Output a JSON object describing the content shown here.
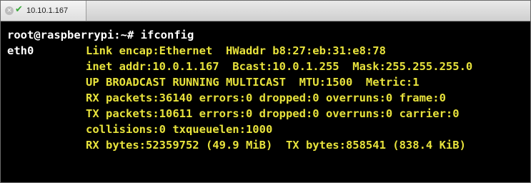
{
  "window": {
    "tab_title": "10.10.1.167",
    "tab_close_glyph": "×",
    "tab_status_glyph": "✔",
    "tab_status_icon": "check-icon",
    "tab_close_icon": "close-icon",
    "colors": {
      "background": "#000000",
      "prompt_text": "#ffffff",
      "output_text": "#e8e33c",
      "check": "#36a836"
    }
  },
  "terminal": {
    "prompt": "root@raspberrypi:~#",
    "command": "ifconfig",
    "interface": "eth0",
    "output_lines": [
      "Link encap:Ethernet  HWaddr b8:27:eb:31:e8:78",
      "inet addr:10.0.1.167  Bcast:10.0.1.255  Mask:255.255.255.0",
      "UP BROADCAST RUNNING MULTICAST  MTU:1500  Metric:1",
      "RX packets:36140 errors:0 dropped:0 overruns:0 frame:0",
      "TX packets:10611 errors:0 dropped:0 overruns:0 carrier:0",
      "collisions:0 txqueuelen:1000",
      "RX bytes:52359752 (49.9 MiB)  TX bytes:858541 (838.4 KiB)"
    ]
  }
}
